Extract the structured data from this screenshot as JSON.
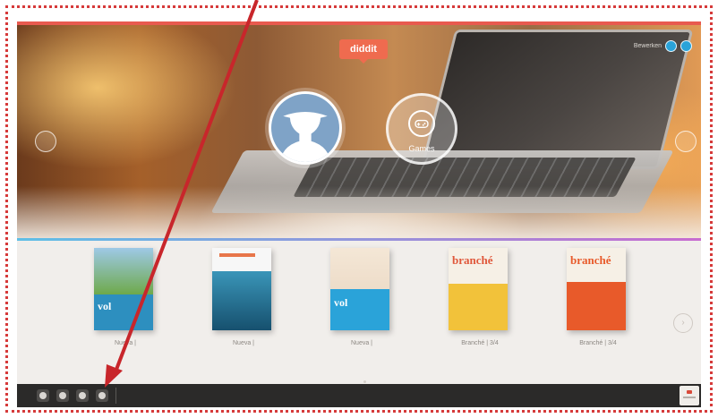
{
  "header": {
    "logo_text": "diddit",
    "account_text": "Bewerken"
  },
  "tiles": {
    "profile_icon": "user-silhouette-icon",
    "games_label": "Games",
    "games_icon": "gamepad-icon"
  },
  "books": [
    {
      "label": "Nueva |",
      "cover_color": "#2d8fbf"
    },
    {
      "label": "Nueva |",
      "cover_color": "#1d6a8c"
    },
    {
      "label": "Nueva |",
      "cover_color": "#2aa3d9"
    },
    {
      "label": "Branché | 3/4",
      "cover_color": "#f2c23a"
    },
    {
      "label": "Branché | 3/4",
      "cover_color": "#e85a2a"
    }
  ],
  "colors": {
    "accent": "#ef6b4f",
    "frame_border": "#d63a3a",
    "arrow": "#c8262b",
    "taskbar": "#2b2a29"
  },
  "annotation": {
    "type": "red-arrow",
    "points_to": "taskbar-button-1"
  }
}
